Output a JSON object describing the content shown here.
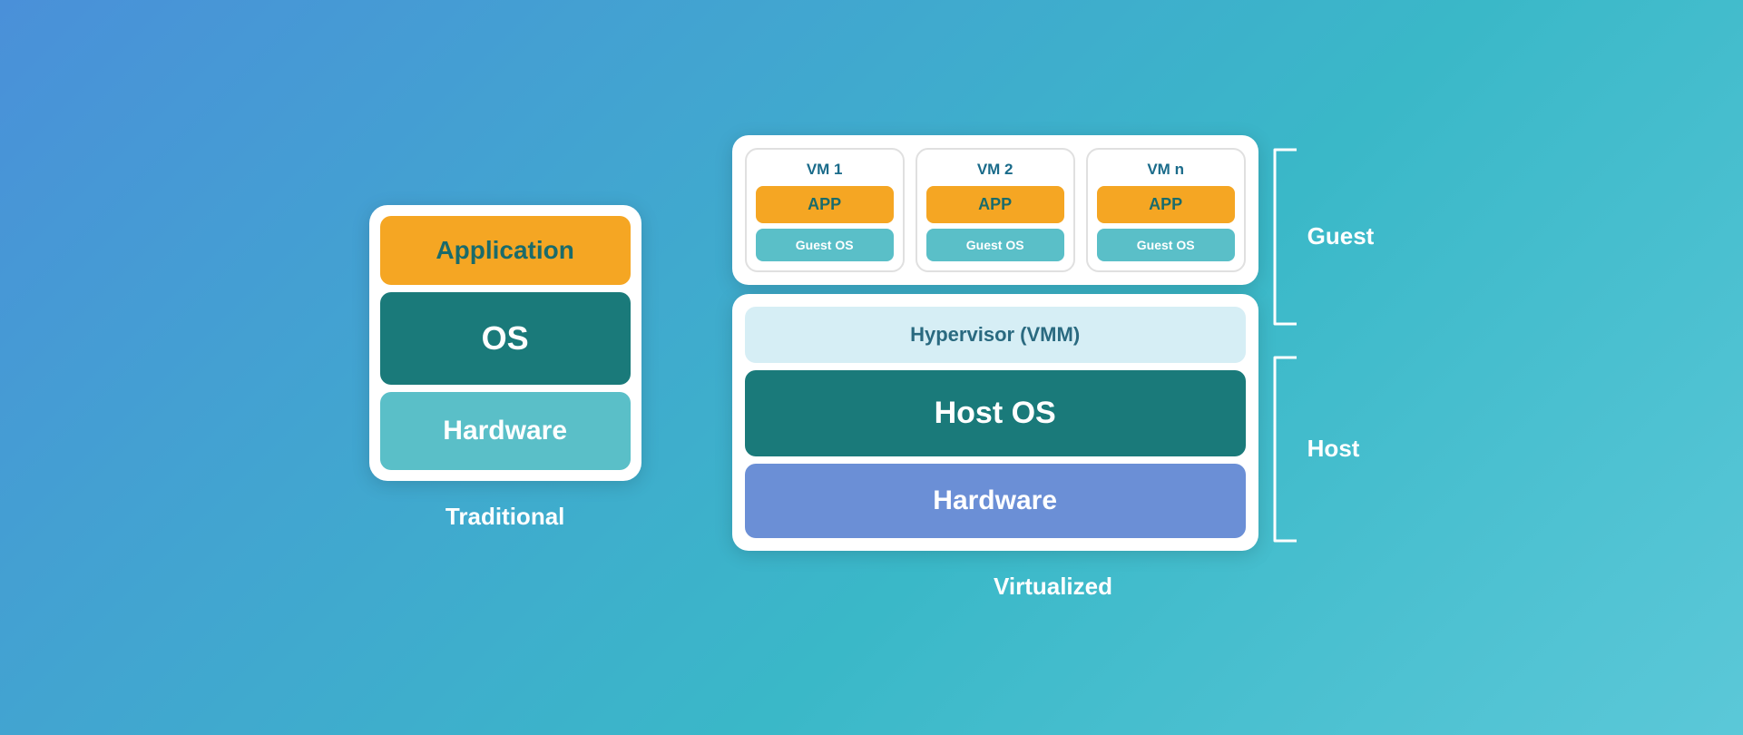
{
  "traditional": {
    "label": "Traditional",
    "stack": {
      "application": "Application",
      "os": "OS",
      "hardware": "Hardware"
    }
  },
  "virtualized": {
    "label": "Virtualized",
    "vms": [
      {
        "title": "VM 1",
        "app": "APP",
        "guestOs": "Guest OS"
      },
      {
        "title": "VM 2",
        "app": "APP",
        "guestOs": "Guest OS"
      },
      {
        "title": "VM n",
        "app": "APP",
        "guestOs": "Guest OS"
      }
    ],
    "host": {
      "hypervisor": "Hypervisor (VMM)",
      "hostOs": "Host OS",
      "hardware": "Hardware"
    },
    "guestLabel": "Guest",
    "hostLabel": "Host"
  }
}
